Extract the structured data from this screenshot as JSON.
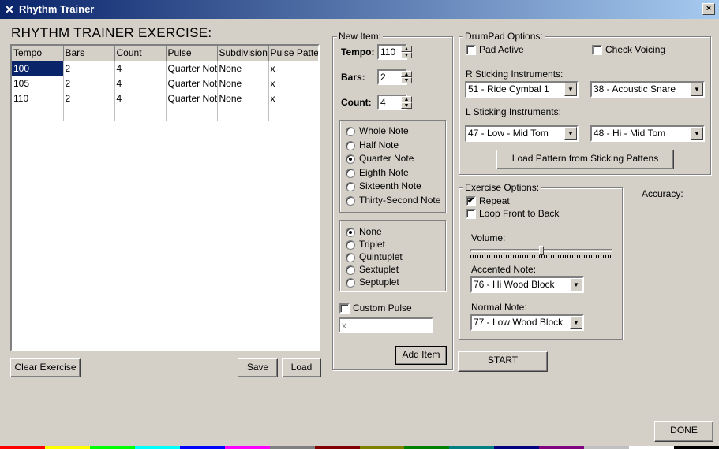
{
  "window": {
    "title": "Rhythm Trainer",
    "close_glyph": "×"
  },
  "exercise": {
    "heading": "RHYTHM TRAINER EXERCISE:",
    "columns": [
      "Tempo",
      "Bars",
      "Count",
      "Pulse",
      "Subdivision",
      "Pulse Pattern"
    ],
    "rows": [
      [
        "100",
        "2",
        "4",
        "Quarter Note",
        "None",
        "x"
      ],
      [
        "105",
        "2",
        "4",
        "Quarter Note",
        "None",
        "x"
      ],
      [
        "110",
        "2",
        "4",
        "Quarter Note",
        "None",
        "x"
      ],
      [
        "",
        "",
        "",
        "",
        "",
        ""
      ]
    ],
    "clear_label": "Clear Exercise",
    "save_label": "Save",
    "load_label": "Load"
  },
  "new_item": {
    "group_label": "New Item:",
    "tempo_label": "Tempo:",
    "tempo_value": "110",
    "bars_label": "Bars:",
    "bars_value": "2",
    "count_label": "Count:",
    "count_value": "4",
    "pulse_options": [
      "Whole Note",
      "Half Note",
      "Quarter Note",
      "Eighth Note",
      "Sixteenth Note",
      "Thirty-Second Note"
    ],
    "pulse_selected": "Quarter Note",
    "subdivision_options": [
      "None",
      "Triplet",
      "Quintuplet",
      "Sextuplet",
      "Septuplet"
    ],
    "subdivision_selected": "None",
    "custom_pulse_label": "Custom Pulse",
    "custom_pulse_checked": false,
    "custom_pulse_value": "x",
    "add_label": "Add Item"
  },
  "drumpad": {
    "group_label": "DrumPad Options:",
    "pad_active_label": "Pad Active",
    "pad_active_checked": false,
    "check_voicing_label": "Check Voicing",
    "check_voicing_checked": false,
    "r_label": "R Sticking Instruments:",
    "r_instrument_1": "51 - Ride Cymbal 1",
    "r_instrument_2": "38 - Acoustic Snare",
    "l_label": "L Sticking Instruments:",
    "l_instrument_1": "47 - Low - Mid Tom",
    "l_instrument_2": "48 - Hi - Mid Tom",
    "load_pattern_label": "Load Pattern from Sticking Pattens"
  },
  "exercise_options": {
    "group_label": "Exercise Options:",
    "repeat_label": "Repeat",
    "repeat_checked": true,
    "loop_label": "Loop Front to Back",
    "loop_checked": false,
    "volume_label": "Volume:",
    "volume_level": 0.5,
    "accented_label": "Accented Note:",
    "accented_value": "76 - Hi Wood Block",
    "normal_label": "Normal Note:",
    "normal_value": "77 - Low Wood Block"
  },
  "accuracy_label": "Accuracy:",
  "start_label": "START",
  "done_label": "DONE",
  "palette_colors": [
    "#ff0000",
    "#ffff00",
    "#00ff00",
    "#00ffff",
    "#0000ff",
    "#ff00ff",
    "#808080",
    "#800000",
    "#808000",
    "#008000",
    "#008080",
    "#000080",
    "#800080",
    "#c0c0c0",
    "#ffffff",
    "#000000"
  ]
}
